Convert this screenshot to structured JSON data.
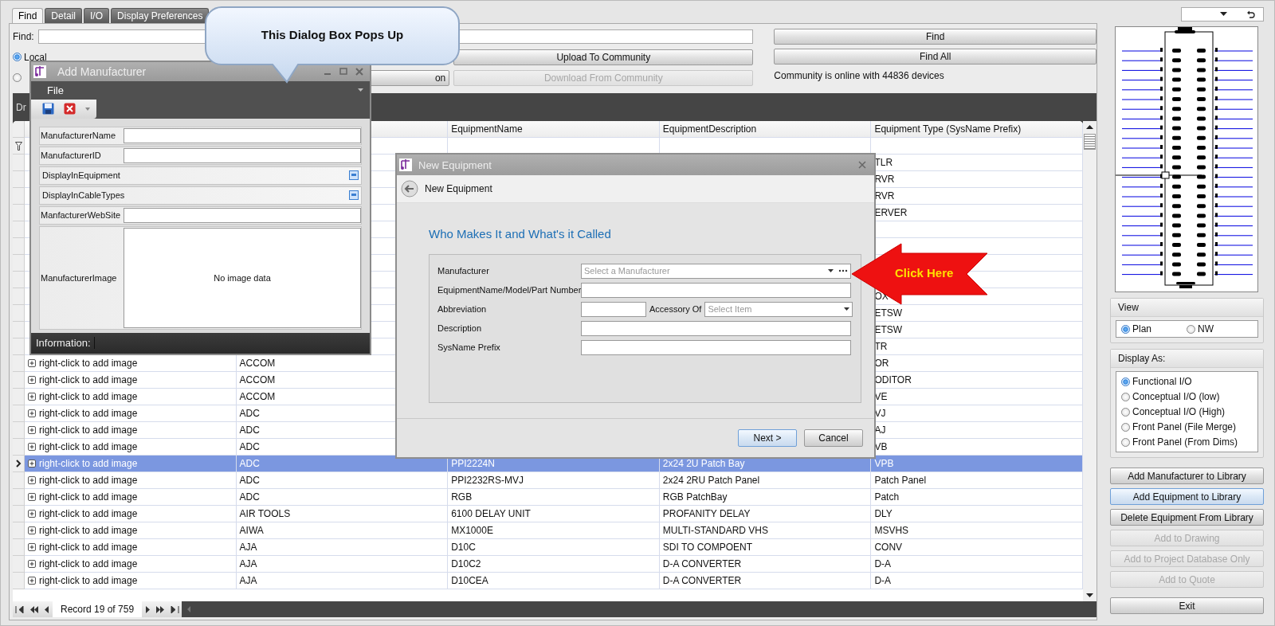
{
  "tabs": [
    {
      "label": "Find",
      "selected": true
    },
    {
      "label": "Detail",
      "selected": false
    },
    {
      "label": "I/O",
      "selected": false
    },
    {
      "label": "Display Preferences",
      "selected": false
    }
  ],
  "find": {
    "label": "Find:"
  },
  "sources": [
    {
      "label": "Local",
      "selected": true
    },
    {
      "selected": false
    }
  ],
  "community_buttons": [
    {
      "label": "Upload To Community",
      "disabled": false
    },
    {
      "label": "on",
      "disabled": false
    },
    {
      "label": "Download From Community",
      "disabled": true
    }
  ],
  "search_buttons": [
    "Find",
    "Find All"
  ],
  "community_status": "Community is online with 44836 devices",
  "grid": {
    "group_panel": "Dr",
    "columns": [
      "",
      "",
      "EquipmentName",
      "EquipmentDescription",
      "Equipment Type (SysName Prefix)"
    ],
    "rows": [
      {
        "selected": false,
        "cells": [
          null,
          null,
          null,
          null,
          "TLR"
        ]
      },
      {
        "selected": false,
        "cells": [
          null,
          null,
          null,
          null,
          "RVR"
        ]
      },
      {
        "selected": false,
        "cells": [
          null,
          null,
          null,
          null,
          "RVR"
        ]
      },
      {
        "selected": false,
        "cells": [
          null,
          null,
          null,
          null,
          "ERVER"
        ]
      },
      {
        "selected": false,
        "cells": [
          null,
          null,
          null,
          null,
          null
        ]
      },
      {
        "selected": false,
        "cells": [
          null,
          null,
          null,
          null,
          null
        ]
      },
      {
        "selected": false,
        "cells": [
          null,
          null,
          null,
          null,
          null
        ]
      },
      {
        "selected": false,
        "cells": [
          null,
          null,
          null,
          null,
          null
        ]
      },
      {
        "selected": false,
        "cells": [
          null,
          null,
          null,
          null,
          "OX"
        ]
      },
      {
        "selected": false,
        "cells": [
          null,
          null,
          null,
          null,
          "ETSW"
        ]
      },
      {
        "selected": false,
        "cells": [
          null,
          null,
          null,
          null,
          "ETSW"
        ]
      },
      {
        "selected": false,
        "cells": [
          null,
          null,
          null,
          null,
          "TR"
        ]
      },
      {
        "selected": false,
        "cells": [
          "right-click to add image",
          "ACCOM",
          null,
          null,
          "OR"
        ]
      },
      {
        "selected": false,
        "cells": [
          "right-click to add image",
          "ACCOM",
          null,
          null,
          "ODITOR"
        ]
      },
      {
        "selected": false,
        "cells": [
          "right-click to add image",
          "ACCOM",
          null,
          null,
          "VE"
        ]
      },
      {
        "selected": false,
        "cells": [
          "right-click to add image",
          "ADC",
          null,
          null,
          "VJ"
        ]
      },
      {
        "selected": false,
        "cells": [
          "right-click to add image",
          "ADC",
          null,
          null,
          "AJ"
        ]
      },
      {
        "selected": false,
        "cells": [
          "right-click to add image",
          "ADC",
          null,
          null,
          "VB"
        ]
      },
      {
        "selected": true,
        "cells": [
          "right-click to add image",
          "ADC",
          "PPI2224N",
          "2x24 2U Patch Bay",
          "VPB"
        ]
      },
      {
        "selected": false,
        "cells": [
          "right-click to add image",
          "ADC",
          "PPI2232RS-MVJ",
          "2x24 2RU Patch Panel",
          "Patch Panel"
        ]
      },
      {
        "selected": false,
        "cells": [
          "right-click to add image",
          "ADC",
          "RGB",
          "RGB PatchBay",
          "Patch"
        ]
      },
      {
        "selected": false,
        "cells": [
          "right-click to add image",
          "AIR TOOLS",
          "6100 DELAY UNIT",
          "PROFANITY DELAY",
          "DLY"
        ]
      },
      {
        "selected": false,
        "cells": [
          "right-click to add image",
          "AIWA",
          "MX1000E",
          "MULTI-STANDARD VHS",
          "MSVHS"
        ]
      },
      {
        "selected": false,
        "cells": [
          "right-click to add image",
          "AJA",
          "D10C",
          "SDI TO COMPOENT",
          "CONV"
        ]
      },
      {
        "selected": false,
        "cells": [
          "right-click to add image",
          "AJA",
          "D10C2",
          "D-A CONVERTER",
          "D-A"
        ]
      },
      {
        "selected": false,
        "cells": [
          "right-click to add image",
          "AJA",
          "D10CEA",
          "D-A CONVERTER",
          "D-A"
        ]
      }
    ],
    "pager": "Record 19 of 759"
  },
  "manufacturer_dialog": {
    "title": "Add Manufacturer",
    "menu": "File",
    "fields": [
      {
        "label": "ManufacturerName",
        "kind": "text"
      },
      {
        "label": "ManufacturerID",
        "kind": "text"
      },
      {
        "label": "DisplayInEquipment",
        "kind": "check"
      },
      {
        "label": "DisplayInCableTypes",
        "kind": "check"
      },
      {
        "label": "ManfacturerWebSite",
        "kind": "text"
      },
      {
        "label": "ManufacturerImage",
        "kind": "image",
        "placeholder": "No image data"
      }
    ],
    "status_label": "Information:"
  },
  "equipment_dialog": {
    "title": "New Equipment",
    "page_title": "New Equipment",
    "heading": "Who Makes It and What's it Called",
    "fields": [
      {
        "label": "Manufacturer",
        "kind": "combo",
        "placeholder": "Select a Manufacturer"
      },
      {
        "label": "EquipmentName/Model/Part Number",
        "kind": "text"
      },
      {
        "label": "Abbreviation",
        "kind": "split",
        "second_label": "Accessory Of",
        "placeholder": "Select Item"
      },
      {
        "label": "Description",
        "kind": "text"
      },
      {
        "label": "SysName Prefix",
        "kind": "text"
      }
    ],
    "buttons": [
      "Next >",
      "Cancel"
    ]
  },
  "callout": "This Dialog Box Pops Up",
  "arrow_label": "Click Here",
  "view": {
    "title": "View",
    "options": [
      {
        "label": "Plan",
        "selected": true
      },
      {
        "label": "NW",
        "selected": false
      }
    ]
  },
  "display_as": {
    "title": "Display As:",
    "options": [
      {
        "label": "Functional I/O",
        "selected": true
      },
      {
        "label": "Conceptual I/O (low)",
        "selected": false
      },
      {
        "label": "Conceptual I/O (High)",
        "selected": false
      },
      {
        "label": "Front Panel (File Merge)",
        "selected": false
      },
      {
        "label": "Front Panel (From Dims)",
        "selected": false
      }
    ]
  },
  "actions": [
    {
      "label": "Add Manufacturer to Library",
      "disabled": false,
      "highlighted": false
    },
    {
      "label": "Add Equipment to Library",
      "disabled": false,
      "highlighted": true
    },
    {
      "label": "Delete Equipment From Library",
      "disabled": false,
      "highlighted": false
    },
    {
      "label": "Add to Drawing",
      "disabled": true,
      "highlighted": false
    },
    {
      "label": "Add to Project Database Only",
      "disabled": true,
      "highlighted": false
    },
    {
      "label": "Add to Quote",
      "disabled": true,
      "highlighted": false
    }
  ],
  "exit": "Exit"
}
